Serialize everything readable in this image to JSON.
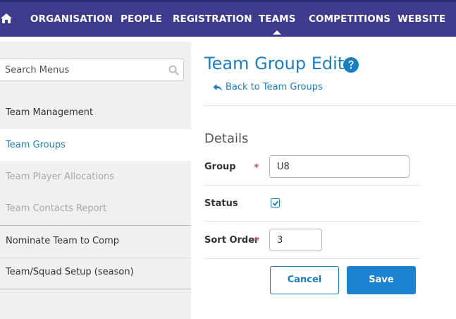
{
  "topnav": {
    "home_icon": "home-icon",
    "items": [
      {
        "label": "ORGANISATION"
      },
      {
        "label": "PEOPLE"
      },
      {
        "label": "REGISTRATION"
      },
      {
        "label": "TEAMS",
        "active": true
      },
      {
        "label": "COMPETITIONS"
      },
      {
        "label": "WEBSITE"
      }
    ]
  },
  "sidebar": {
    "search": {
      "placeholder": "Search Menus",
      "value": "",
      "icon": "search-icon"
    },
    "items": [
      {
        "label": "Team Management"
      },
      {
        "label": "Team Groups",
        "active": true
      },
      {
        "label": "Team Player Allocations",
        "disabled": true
      },
      {
        "label": "Team Contacts Report",
        "disabled": true
      },
      {
        "label": "Nominate Team to Comp"
      },
      {
        "label": "Team/Squad Setup (season)"
      }
    ]
  },
  "main": {
    "title": "Team Group Edit",
    "help_icon": "question-circle-icon",
    "back_link": "Back to Team Groups",
    "section_title": "Details",
    "form": {
      "group_label": "Group",
      "group_required_mark": "*",
      "group_value": "U8",
      "status_label": "Status",
      "status_checked": true,
      "sort_order_label": "Sort Order",
      "sort_order_required_mark": "*",
      "sort_order_value": "3"
    },
    "buttons": {
      "cancel_label": "Cancel",
      "save_label": "Save"
    }
  },
  "colors": {
    "nav_bg": "#3f3c8f",
    "accent": "#1a7ec2",
    "save_button": "#1a82d0",
    "required": "#d9534f",
    "sidebar_bg": "#f0f0f0"
  }
}
